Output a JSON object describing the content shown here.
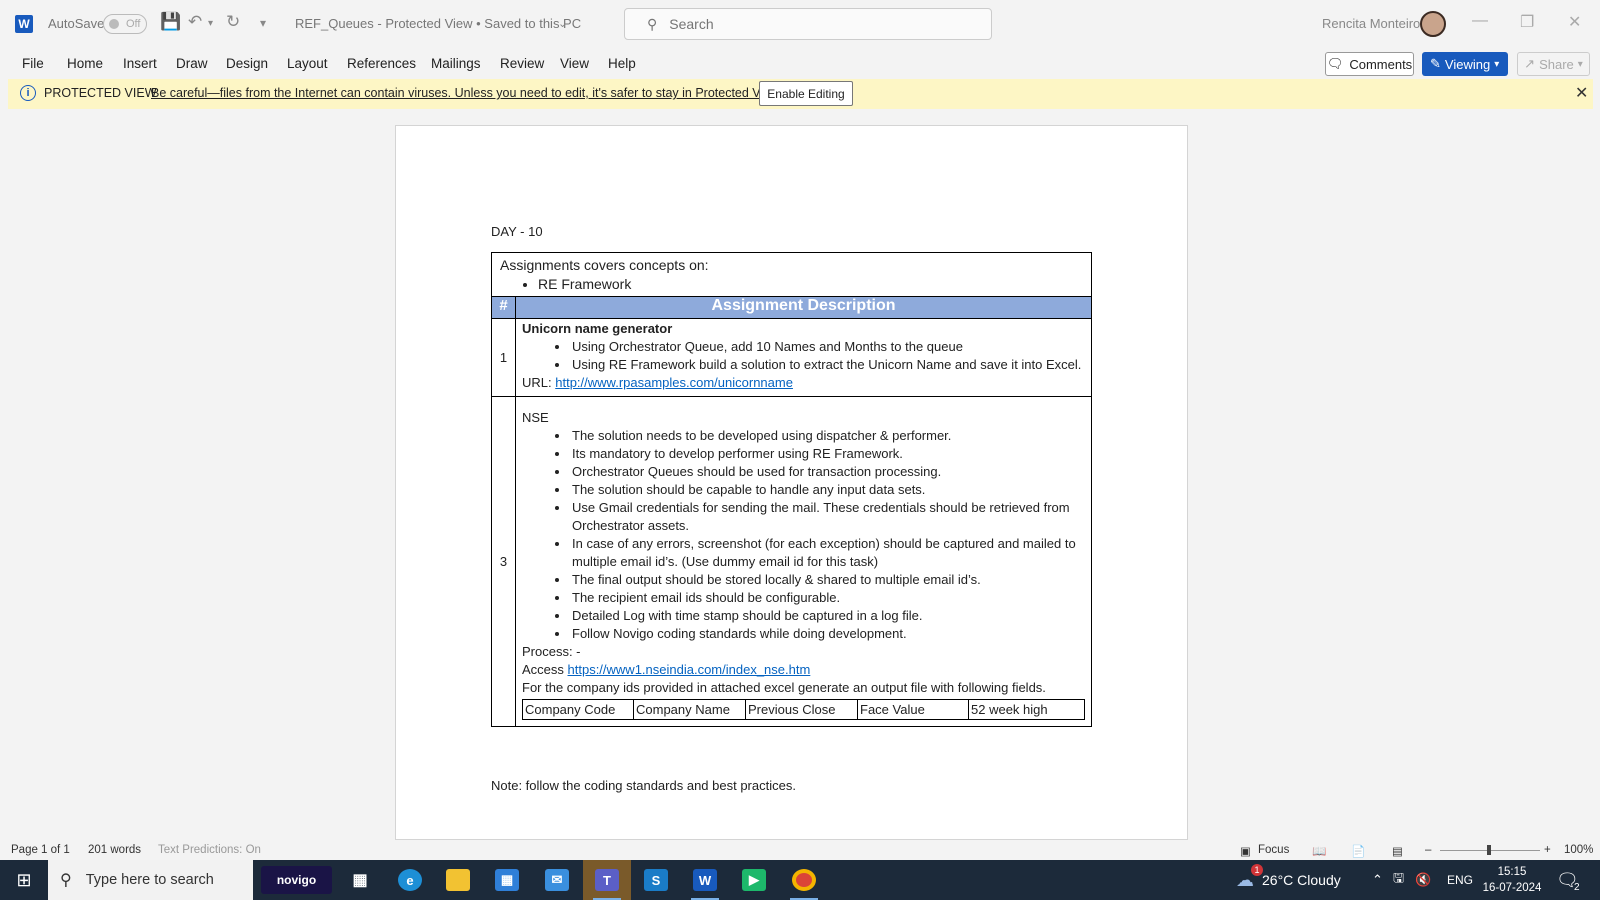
{
  "app": {
    "autosave_label": "AutoSave",
    "autosave_state": "Off",
    "doc_title": "REF_Queues  -  Protected View  •  Saved to this PC",
    "search_placeholder": "Search",
    "user_name": "Rencita Monteiro"
  },
  "menu": [
    "File",
    "Home",
    "Insert",
    "Draw",
    "Design",
    "Layout",
    "References",
    "Mailings",
    "Review",
    "View",
    "Help"
  ],
  "actions": {
    "comments": "Comments",
    "viewing": "Viewing",
    "share": "Share"
  },
  "protected_view": {
    "title": "PROTECTED VIEW",
    "message": "Be careful—files from the Internet can contain viruses. Unless you need to edit, it's safer to stay in Protected View.",
    "button": "Enable Editing"
  },
  "document": {
    "day": "DAY - 10",
    "concepts_intro": "Assignments covers concepts on:",
    "concepts": [
      "RE Framework"
    ],
    "header": {
      "num": "#",
      "desc": "Assignment Description"
    },
    "row1": {
      "num": "1",
      "title": "Unicorn name generator",
      "bullets": [
        "Using Orchestrator Queue, add 10 Names and Months to the queue",
        "Using RE Framework build a solution to extract the Unicorn Name and save it into Excel."
      ],
      "url_label": "URL: ",
      "url": "http://www.rpasamples.com/unicornname"
    },
    "row3": {
      "num": "3",
      "title": "NSE",
      "bullets": [
        "The solution needs to be developed using dispatcher & performer.",
        "Its mandatory to develop performer using RE Framework.",
        "Orchestrator Queues should be used for transaction processing.",
        "The solution should be capable to handle any input data sets.",
        "Use Gmail credentials for sending the mail. These credentials should be retrieved from Orchestrator assets.",
        "In case of any errors, screenshot (for each exception) should be captured and mailed to multiple email id’s.  (Use dummy email id for this task)",
        "The final output should be stored locally & shared to multiple email id’s.",
        "The recipient email ids should be configurable.",
        "Detailed Log with time stamp should be captured in a log file.",
        "Follow Novigo coding standards while doing development."
      ],
      "process_label": "Process: -",
      "access_label": "Access ",
      "access_url": "https://www1.nseindia.com/index_nse.htm",
      "instruction": "For the company ids provided in attached excel generate an output file with following fields.",
      "fields": [
        "Company Code",
        "Company Name",
        "Previous Close",
        "Face Value",
        "52 week high"
      ]
    },
    "note": "Note: follow the coding standards and best practices."
  },
  "status": {
    "page": "Page 1 of 1",
    "words": "201 words",
    "predictions": "Text Predictions: On",
    "focus": "Focus",
    "zoom": "100%"
  },
  "taskbar": {
    "search_placeholder": "Type here to search",
    "novigo": "novigo",
    "weather": "26°C  Cloudy",
    "weather_badge": "1",
    "language": "ENG",
    "time": "15:15",
    "date": "16-07-2024",
    "notifications": "2"
  },
  "colors": {
    "word_blue": "#185abd",
    "header_fill": "#8eaadb",
    "protected_bar": "#fdf6c5",
    "link": "#0563c1",
    "taskbar": "#1c2a3a"
  }
}
